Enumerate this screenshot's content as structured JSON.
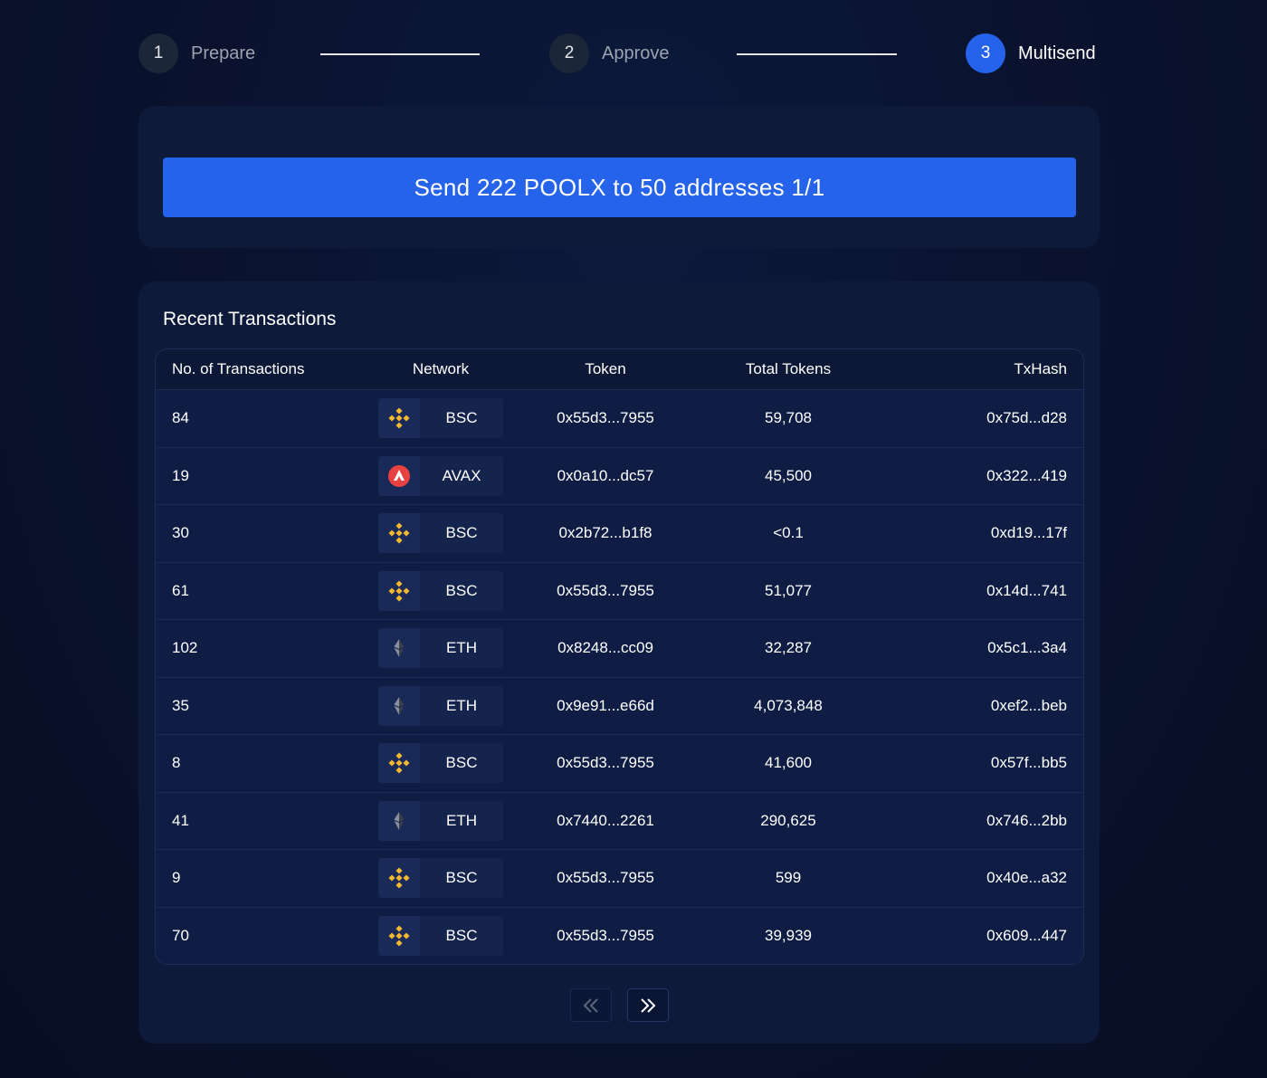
{
  "stepper": {
    "steps": [
      {
        "number": "1",
        "label": "Prepare",
        "active": false
      },
      {
        "number": "2",
        "label": "Approve",
        "active": false
      },
      {
        "number": "3",
        "label": "Multisend",
        "active": true
      }
    ]
  },
  "send": {
    "button_label": "Send 222 POOLX to 50 addresses 1/1"
  },
  "transactions": {
    "title": "Recent Transactions",
    "columns": [
      "No. of Transactions",
      "Network",
      "Token",
      "Total Tokens",
      "TxHash"
    ],
    "rows": [
      {
        "count": "84",
        "network": "BSC",
        "icon": "bnb-icon",
        "token": "0x55d3...7955",
        "total": "59,708",
        "txhash": "0x75d...d28"
      },
      {
        "count": "19",
        "network": "AVAX",
        "icon": "avax-icon",
        "token": "0x0a10...dc57",
        "total": "45,500",
        "txhash": "0x322...419"
      },
      {
        "count": "30",
        "network": "BSC",
        "icon": "bnb-icon",
        "token": "0x2b72...b1f8",
        "total": "<0.1",
        "txhash": "0xd19...17f"
      },
      {
        "count": "61",
        "network": "BSC",
        "icon": "bnb-icon",
        "token": "0x55d3...7955",
        "total": "51,077",
        "txhash": "0x14d...741"
      },
      {
        "count": "102",
        "network": "ETH",
        "icon": "eth-icon",
        "token": "0x8248...cc09",
        "total": "32,287",
        "txhash": "0x5c1...3a4"
      },
      {
        "count": "35",
        "network": "ETH",
        "icon": "eth-icon",
        "token": "0x9e91...e66d",
        "total": "4,073,848",
        "txhash": "0xef2...beb"
      },
      {
        "count": "8",
        "network": "BSC",
        "icon": "bnb-icon",
        "token": "0x55d3...7955",
        "total": "41,600",
        "txhash": "0x57f...bb5"
      },
      {
        "count": "41",
        "network": "ETH",
        "icon": "eth-icon",
        "token": "0x7440...2261",
        "total": "290,625",
        "txhash": "0x746...2bb"
      },
      {
        "count": "9",
        "network": "BSC",
        "icon": "bnb-icon",
        "token": "0x55d3...7955",
        "total": "599",
        "txhash": "0x40e...a32"
      },
      {
        "count": "70",
        "network": "BSC",
        "icon": "bnb-icon",
        "token": "0x55d3...7955",
        "total": "39,939",
        "txhash": "0x609...447"
      }
    ]
  },
  "pagination": {
    "prev_icon": "double-chevron-left-icon",
    "next_icon": "double-chevron-right-icon"
  },
  "colors": {
    "accent": "#2563eb",
    "background": "#0a1330",
    "card": "#0d1a3a",
    "bnb": "#f3ba2f",
    "avax": "#e84142"
  }
}
